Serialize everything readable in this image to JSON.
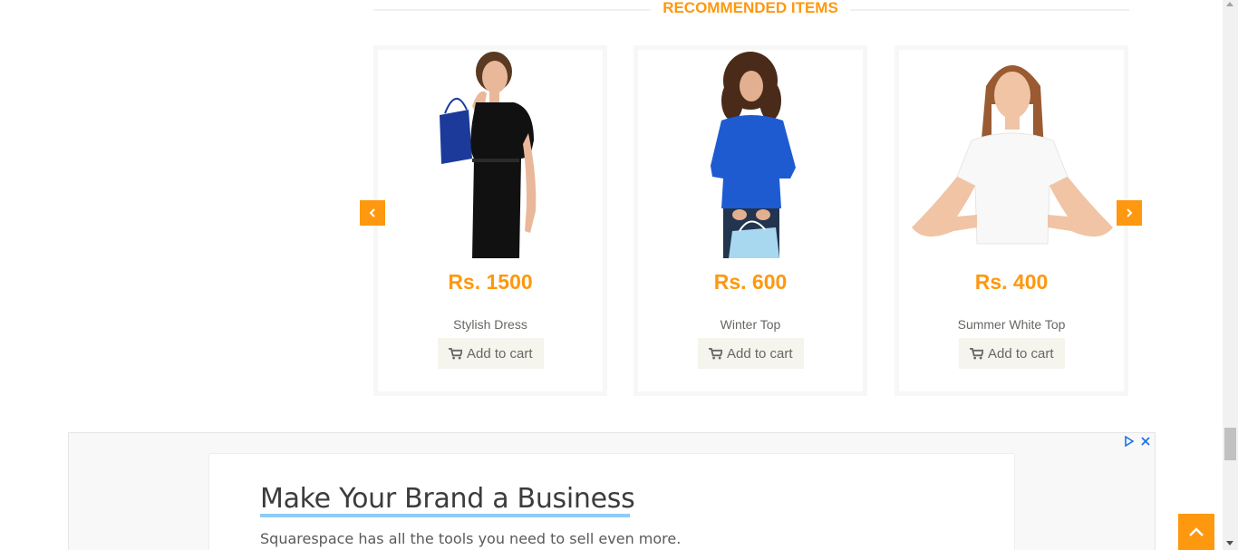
{
  "section": {
    "title": "RECOMMENDED ITEMS"
  },
  "carousel": {
    "prev_icon": "chevron-left-icon",
    "next_icon": "chevron-right-icon"
  },
  "products": [
    {
      "price": "Rs. 1500",
      "name": "Stylish Dress",
      "cart_label": "Add to cart",
      "image": "woman-black-dress-shopping-bag"
    },
    {
      "price": "Rs. 600",
      "name": "Winter Top",
      "cart_label": "Add to cart",
      "image": "woman-blue-top-shopping-bag"
    },
    {
      "price": "Rs. 400",
      "name": "Summer White Top",
      "cart_label": "Add to cart",
      "image": "woman-white-tshirt"
    }
  ],
  "ad": {
    "headline": "Make Your Brand a Business",
    "subtext": "Squarespace has all the tools you need to sell even more.",
    "icons": [
      "adchoices-icon",
      "close-icon"
    ]
  },
  "colors": {
    "accent": "#fe980f",
    "text": "#696763",
    "button_bg": "#f5f5ed"
  }
}
